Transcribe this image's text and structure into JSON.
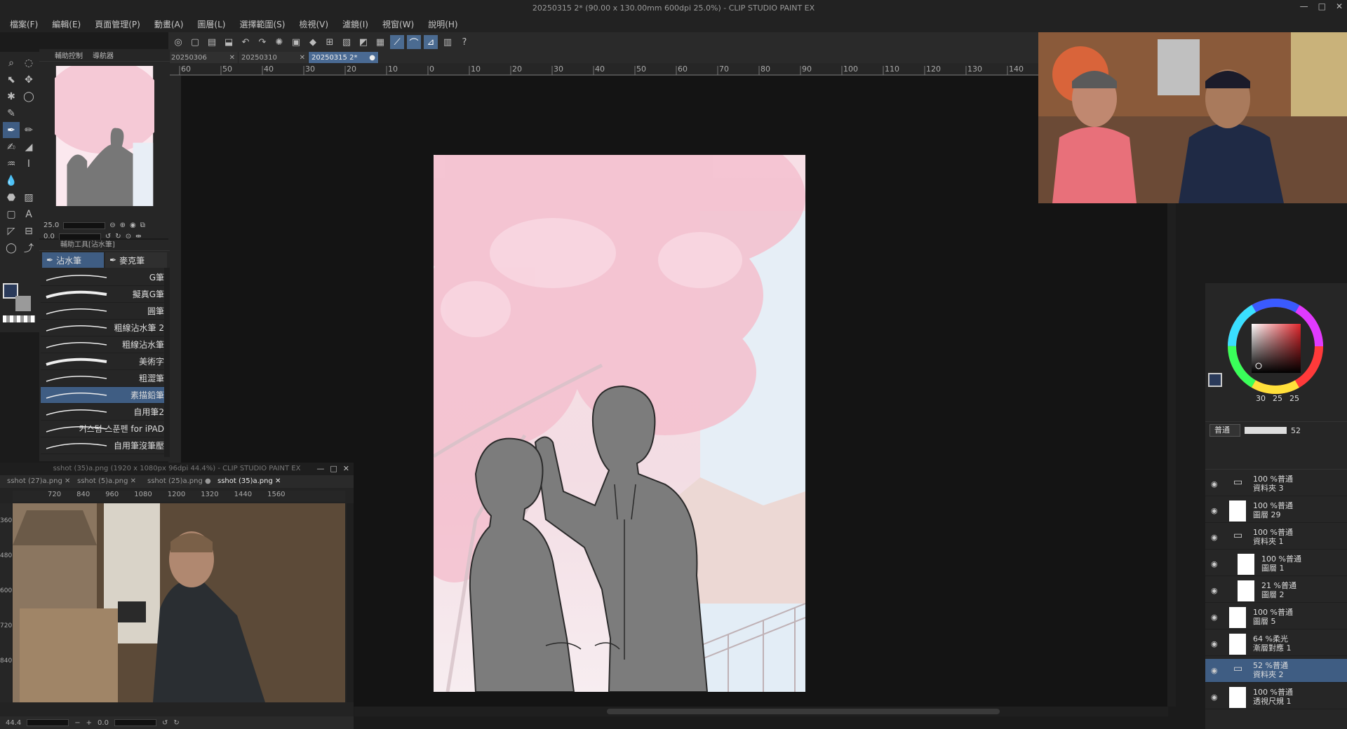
{
  "window": {
    "title": "20250315 2* (90.00 x 130.00mm 600dpi 25.0%) - CLIP STUDIO PAINT EX",
    "controls": [
      "—",
      "□",
      "✕"
    ]
  },
  "menu": [
    "檔案(F)",
    "編輯(E)",
    "頁面管理(P)",
    "動畫(A)",
    "圖層(L)",
    "選擇範圍(S)",
    "檢視(V)",
    "濾鏡(I)",
    "視窗(W)",
    "說明(H)"
  ],
  "doc_tabs": [
    {
      "label": "20250306",
      "close": "✕"
    },
    {
      "label": "20250310",
      "close": "✕"
    },
    {
      "label": "20250315 2*",
      "close": "●"
    }
  ],
  "ruler_ticks": [
    "60",
    "50",
    "40",
    "30",
    "20",
    "10",
    "0",
    "10",
    "20",
    "30",
    "40",
    "50",
    "60",
    "70",
    "80",
    "90",
    "100",
    "110",
    "120",
    "130",
    "140"
  ],
  "nav_panel": {
    "tabs": [
      "輔助控制",
      "導航器"
    ],
    "zoom": "25.0",
    "rotate": "0.0"
  },
  "subtool": {
    "header": "輔助工具[沾水筆]",
    "tabs": [
      "沾水筆",
      "麥克筆"
    ],
    "brushes": [
      "G筆",
      "擬真G筆",
      "圓筆",
      "粗線沾水筆 2",
      "粗線沾水筆",
      "美術字",
      "粗澀筆",
      "素描鉛筆",
      "自用筆2",
      "커스텀 스푼펜 for iPAD",
      "自用筆沒筆壓"
    ],
    "selected": "素描鉛筆"
  },
  "sub_window": {
    "title": "sshot (35)a.png (1920 x 1080px 96dpi 44.4%) - CLIP STUDIO PAINT EX",
    "tabs": [
      "sshot (27)a.png",
      "sshot (5)a.png",
      "sshot (25)a.png",
      "sshot (35)a.png"
    ],
    "ruler": [
      "720",
      "840",
      "960",
      "1080",
      "1200",
      "1320",
      "1440",
      "1560"
    ],
    "vruler": [
      "360",
      "480",
      "600",
      "720",
      "840"
    ],
    "zoom": "44.4",
    "angle": "0.0"
  },
  "color": {
    "r": "30",
    "g": "25",
    "b": "25",
    "main": "#2a3a5a",
    "sub": "#9a9a9a"
  },
  "layer_panel": {
    "blend_mode": "普通",
    "opacity": "52",
    "layers": [
      {
        "opacity": "100 %普通",
        "name": "資料夾 3",
        "type": "folder"
      },
      {
        "opacity": "100 %普通",
        "name": "圖層 29",
        "type": "layer"
      },
      {
        "opacity": "100 %普通",
        "name": "資料夾 1",
        "type": "folder"
      },
      {
        "opacity": "100 %普通",
        "name": "圖層 1",
        "type": "layer"
      },
      {
        "opacity": "21 %普通",
        "name": "圖層 2",
        "type": "layer"
      },
      {
        "opacity": "100 %普通",
        "name": "圖層 5",
        "type": "layer"
      },
      {
        "opacity": "64 %柔光",
        "name": "漸層對應 1",
        "type": "adjust"
      },
      {
        "opacity": "52 %普通",
        "name": "資料夾 2",
        "type": "folder"
      },
      {
        "opacity": "100 %普通",
        "name": "透視尺規 1",
        "type": "ruler"
      }
    ]
  }
}
